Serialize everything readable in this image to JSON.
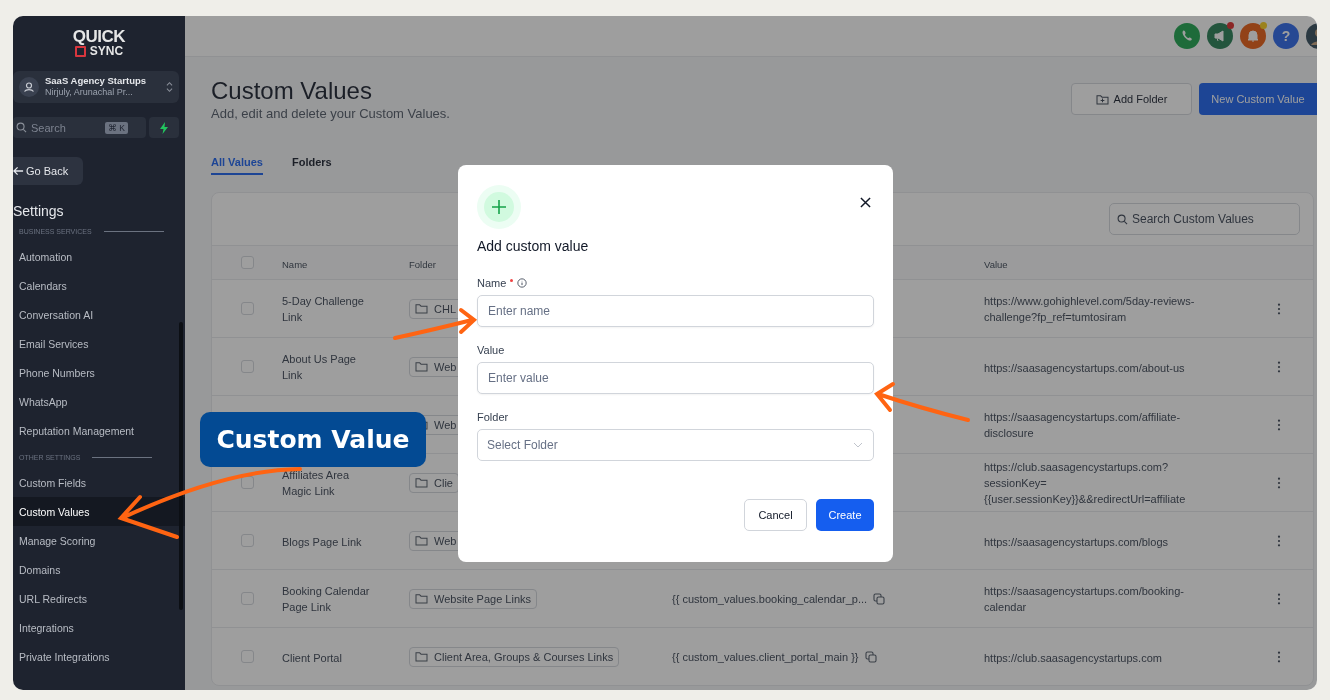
{
  "sidebar": {
    "logo": {
      "top": "QUICK",
      "bottom": "SYNC"
    },
    "account": {
      "name": "SaaS Agency Startups",
      "location": "Nirjuly, Arunachal Pr..."
    },
    "search": {
      "placeholder": "Search",
      "shortcut": "⌘ K"
    },
    "back_button": "Go Back",
    "heading": "Settings",
    "sections": [
      {
        "title": "BUSINESS SERVICES",
        "items": [
          {
            "label": "Automation",
            "selected": false
          },
          {
            "label": "Calendars",
            "selected": false
          },
          {
            "label": "Conversation AI",
            "selected": false
          },
          {
            "label": "Email Services",
            "selected": false
          },
          {
            "label": "Phone Numbers",
            "selected": false
          },
          {
            "label": "WhatsApp",
            "selected": false
          },
          {
            "label": "Reputation Management",
            "selected": false
          }
        ]
      },
      {
        "title": "OTHER SETTINGS",
        "items": [
          {
            "label": "Custom Fields",
            "selected": false
          },
          {
            "label": "Custom Values",
            "selected": true
          },
          {
            "label": "Manage Scoring",
            "selected": false
          },
          {
            "label": "Domains",
            "selected": false
          },
          {
            "label": "URL Redirects",
            "selected": false
          },
          {
            "label": "Integrations",
            "selected": false
          },
          {
            "label": "Private Integrations",
            "selected": false
          }
        ]
      }
    ]
  },
  "topbar": {
    "help": "?"
  },
  "page": {
    "title": "Custom Values",
    "subtitle": "Add, edit and delete your Custom Values.",
    "buttons": [
      "Add Folder",
      "New Custom Value"
    ]
  },
  "tabs": [
    {
      "label": "All Values",
      "selected": true
    },
    {
      "label": "Folders",
      "selected": false
    }
  ],
  "table": {
    "search": {
      "placeholder": "Search Custom Values"
    },
    "all_checked": false,
    "columns": [
      "Name",
      "Folder",
      "Value"
    ],
    "rows": [
      {
        "checked": false,
        "name": "5-Day Challenge Link",
        "folder": "CHL",
        "value": "https://www.gohighlevel.com/5day-reviews-challenge?fp_ref=tumtosiram"
      },
      {
        "checked": false,
        "name": "About Us Page Link",
        "folder": "Web",
        "value": "https://saasagencystartups.com/about-us"
      },
      {
        "folder": "Web",
        "value": "https://saasagencystartups.com/affiliate-disclosure"
      },
      {
        "checked": false,
        "name": "Affiliates Area Magic Link",
        "folder": "Clie",
        "value": "https://club.saasagencystartups.com?sessionKey={{user.sessionKey}}&&redirectUrl=affiliate"
      },
      {
        "checked": false,
        "name": "Blogs Page Link",
        "folder": "Web",
        "value": "https://saasagencystartups.com/blogs"
      },
      {
        "checked": false,
        "name": "Booking Calendar Page Link",
        "folder": "Website Page Links",
        "key": "{{ custom_values.booking_calendar_p...",
        "value": "https://saasagencystartups.com/booking-calendar"
      },
      {
        "checked": false,
        "name": "Client Portal",
        "folder": "Client Area, Groups & Courses Links",
        "key": "{{ custom_values.client_portal_main }}",
        "value": "https://club.saasagencystartups.com"
      }
    ]
  },
  "modal": {
    "title": "Add custom value",
    "fields": [
      {
        "kind": "text",
        "label": "Name",
        "required": true,
        "info": true,
        "placeholder": "Enter name"
      },
      {
        "kind": "text",
        "label": "Value",
        "placeholder": "Enter value"
      },
      {
        "kind": "select",
        "label": "Folder",
        "placeholder": "Select Folder"
      }
    ],
    "buttons": [
      {
        "label": "Cancel",
        "kind": "secondary"
      },
      {
        "label": "Create",
        "kind": "primary"
      }
    ]
  },
  "annotation": {
    "callout": "Custom Value"
  }
}
